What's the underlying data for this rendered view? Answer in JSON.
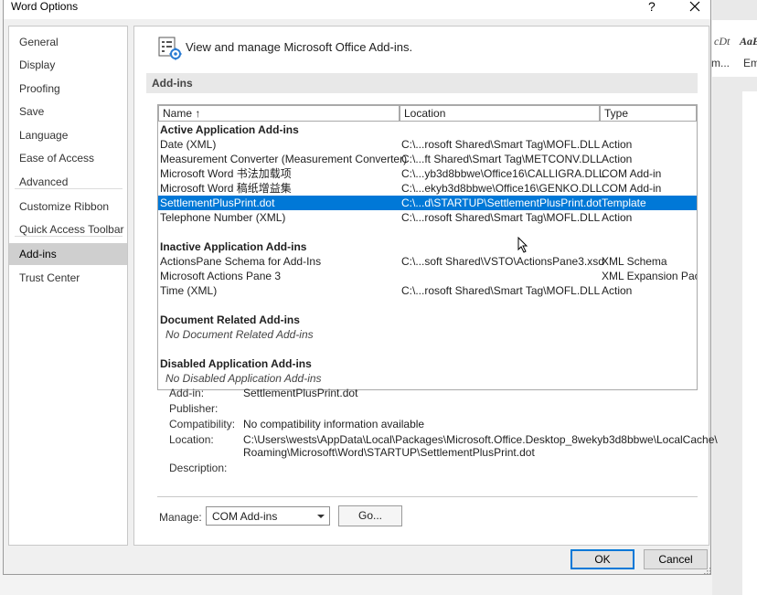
{
  "background": {
    "style1": "cDt",
    "style2": "AaE",
    "style1_caption": "m...",
    "style2_caption": "Em"
  },
  "dialog": {
    "title": "Word Options",
    "help": "?"
  },
  "nav": {
    "items": [
      {
        "label": "General"
      },
      {
        "label": "Display"
      },
      {
        "label": "Proofing"
      },
      {
        "label": "Save"
      },
      {
        "label": "Language"
      },
      {
        "label": "Ease of Access"
      },
      {
        "label": "Advanced"
      },
      {
        "label": "Customize Ribbon"
      },
      {
        "label": "Quick Access Toolbar"
      },
      {
        "label": "Add-ins"
      },
      {
        "label": "Trust Center"
      }
    ],
    "selected": "Add-ins"
  },
  "content": {
    "header": "View and manage Microsoft Office Add-ins.",
    "section": "Add-ins",
    "columns": {
      "name": "Name ↑",
      "location": "Location",
      "type": "Type"
    },
    "groups": {
      "active": "Active Application Add-ins",
      "inactive": "Inactive Application Add-ins",
      "document": "Document Related Add-ins",
      "disabled": "Disabled Application Add-ins"
    },
    "active_rows": [
      {
        "name": "Date (XML)",
        "location": "C:\\...rosoft Shared\\Smart Tag\\MOFL.DLL",
        "type": "Action"
      },
      {
        "name": "Measurement Converter (Measurement Converter)",
        "location": "C:\\...ft Shared\\Smart Tag\\METCONV.DLL",
        "type": "Action"
      },
      {
        "name": "Microsoft Word 书法加载项",
        "location": "C:\\...yb3d8bbwe\\Office16\\CALLIGRA.DLL",
        "type": "COM Add-in"
      },
      {
        "name": "Microsoft Word 稿纸增益集",
        "location": "C:\\...ekyb3d8bbwe\\Office16\\GENKO.DLL",
        "type": "COM Add-in"
      },
      {
        "name": "SettlementPlusPrint.dot",
        "location": "C:\\...d\\STARTUP\\SettlementPlusPrint.dot",
        "type": "Template"
      },
      {
        "name": "Telephone Number (XML)",
        "location": "C:\\...rosoft Shared\\Smart Tag\\MOFL.DLL",
        "type": "Action"
      }
    ],
    "inactive_rows": [
      {
        "name": "ActionsPane Schema for Add-Ins",
        "location": "C:\\...soft Shared\\VSTO\\ActionsPane3.xsd",
        "type": "XML Schema"
      },
      {
        "name": "Microsoft Actions Pane 3",
        "location": "",
        "type": "XML Expansion Pack"
      },
      {
        "name": "Time (XML)",
        "location": "C:\\...rosoft Shared\\Smart Tag\\MOFL.DLL",
        "type": "Action"
      }
    ],
    "no_document": "No Document Related Add-ins",
    "no_disabled": "No Disabled Application Add-ins",
    "selected_row": "SettlementPlusPrint.dot",
    "details": {
      "addin_label": "Add-in:",
      "addin_value": "SettlementPlusPrint.dot",
      "publisher_label": "Publisher:",
      "publisher_value": "",
      "compat_label": "Compatibility:",
      "compat_value": "No compatibility information available",
      "location_label": "Location:",
      "location_line1": "C:\\Users\\wests\\AppData\\Local\\Packages\\Microsoft.Office.Desktop_8wekyb3d8bbwe\\LocalCache\\",
      "location_line2": "Roaming\\Microsoft\\Word\\STARTUP\\SettlementPlusPrint.dot",
      "description_label": "Description:",
      "description_value": ""
    },
    "manage": {
      "label": "Manage:",
      "value": "COM Add-ins",
      "go": "Go..."
    }
  },
  "buttons": {
    "ok": "OK",
    "cancel": "Cancel"
  },
  "colors": {
    "selection": "#0078d7",
    "nav_selected": "#cfcfcf"
  }
}
